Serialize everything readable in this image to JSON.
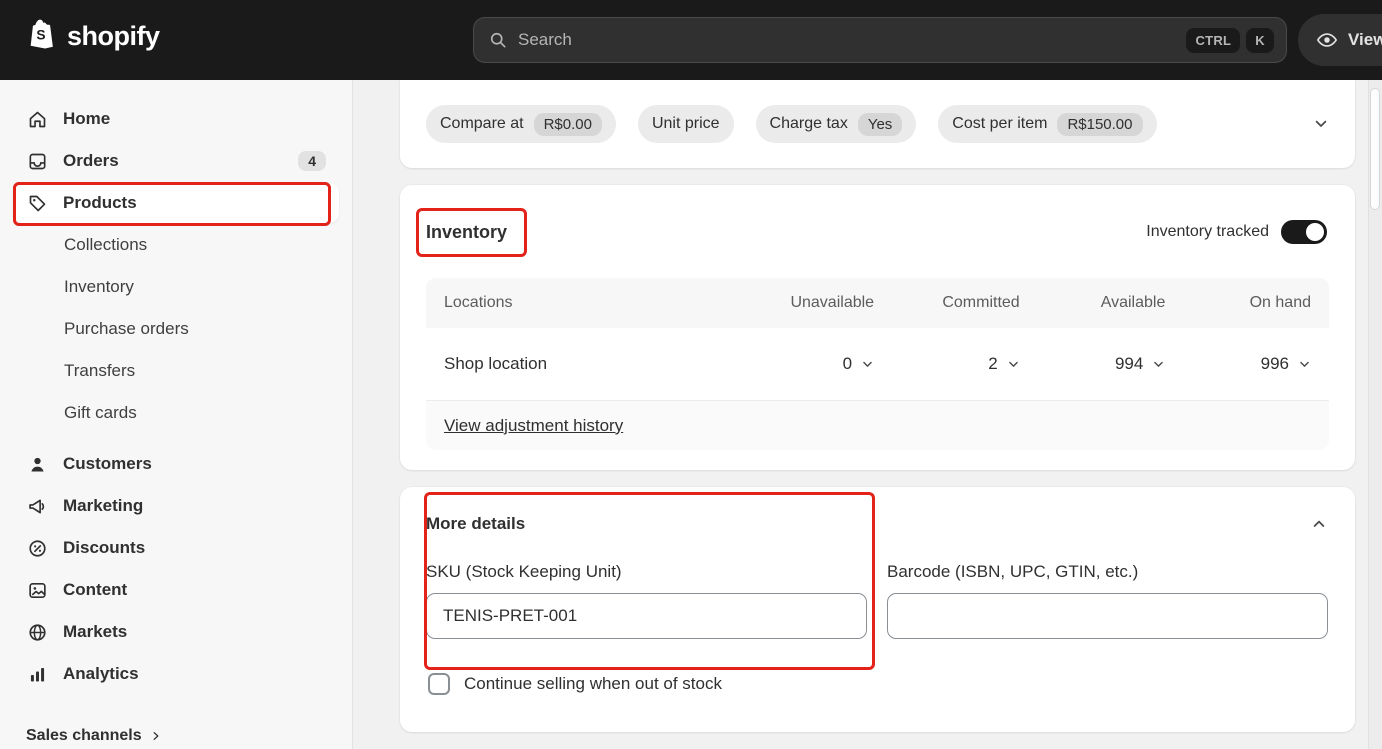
{
  "topbar": {
    "brand": "shopify",
    "search": {
      "placeholder": "Search",
      "shortcuts": [
        "CTRL",
        "K"
      ]
    },
    "view_button_label": "View"
  },
  "sidebar": {
    "items": [
      {
        "label": "Home"
      },
      {
        "label": "Orders",
        "badge": "4"
      },
      {
        "label": "Products"
      },
      {
        "label": "Collections"
      },
      {
        "label": "Inventory"
      },
      {
        "label": "Purchase orders"
      },
      {
        "label": "Transfers"
      },
      {
        "label": "Gift cards"
      },
      {
        "label": "Customers"
      },
      {
        "label": "Marketing"
      },
      {
        "label": "Discounts"
      },
      {
        "label": "Content"
      },
      {
        "label": "Markets"
      },
      {
        "label": "Analytics"
      }
    ],
    "footer_label": "Sales channels"
  },
  "pricing_card": {
    "pills": [
      {
        "label": "Compare at",
        "value": "R$0.00"
      },
      {
        "label": "Unit price"
      },
      {
        "label": "Charge tax",
        "value": "Yes"
      },
      {
        "label": "Cost per item",
        "value": "R$150.00"
      }
    ]
  },
  "inventory_card": {
    "title": "Inventory",
    "tracked_label": "Inventory tracked",
    "tracked_state": "on",
    "table": {
      "headers": [
        "Locations",
        "Unavailable",
        "Committed",
        "Available",
        "On hand"
      ],
      "rows": [
        {
          "location": "Shop location",
          "unavailable": "0",
          "committed": "2",
          "available": "994",
          "on_hand": "996"
        }
      ],
      "footer_link": "View adjustment history"
    }
  },
  "more_details_card": {
    "title": "More details",
    "sku_label": "SKU (Stock Keeping Unit)",
    "sku_value": "TENIS-PRET-001",
    "barcode_label": "Barcode (ISBN, UPC, GTIN, etc.)",
    "barcode_value": "",
    "checkbox_label": "Continue selling when out of stock",
    "checkbox_checked": false
  },
  "annotations": {
    "color": "#e32219"
  }
}
